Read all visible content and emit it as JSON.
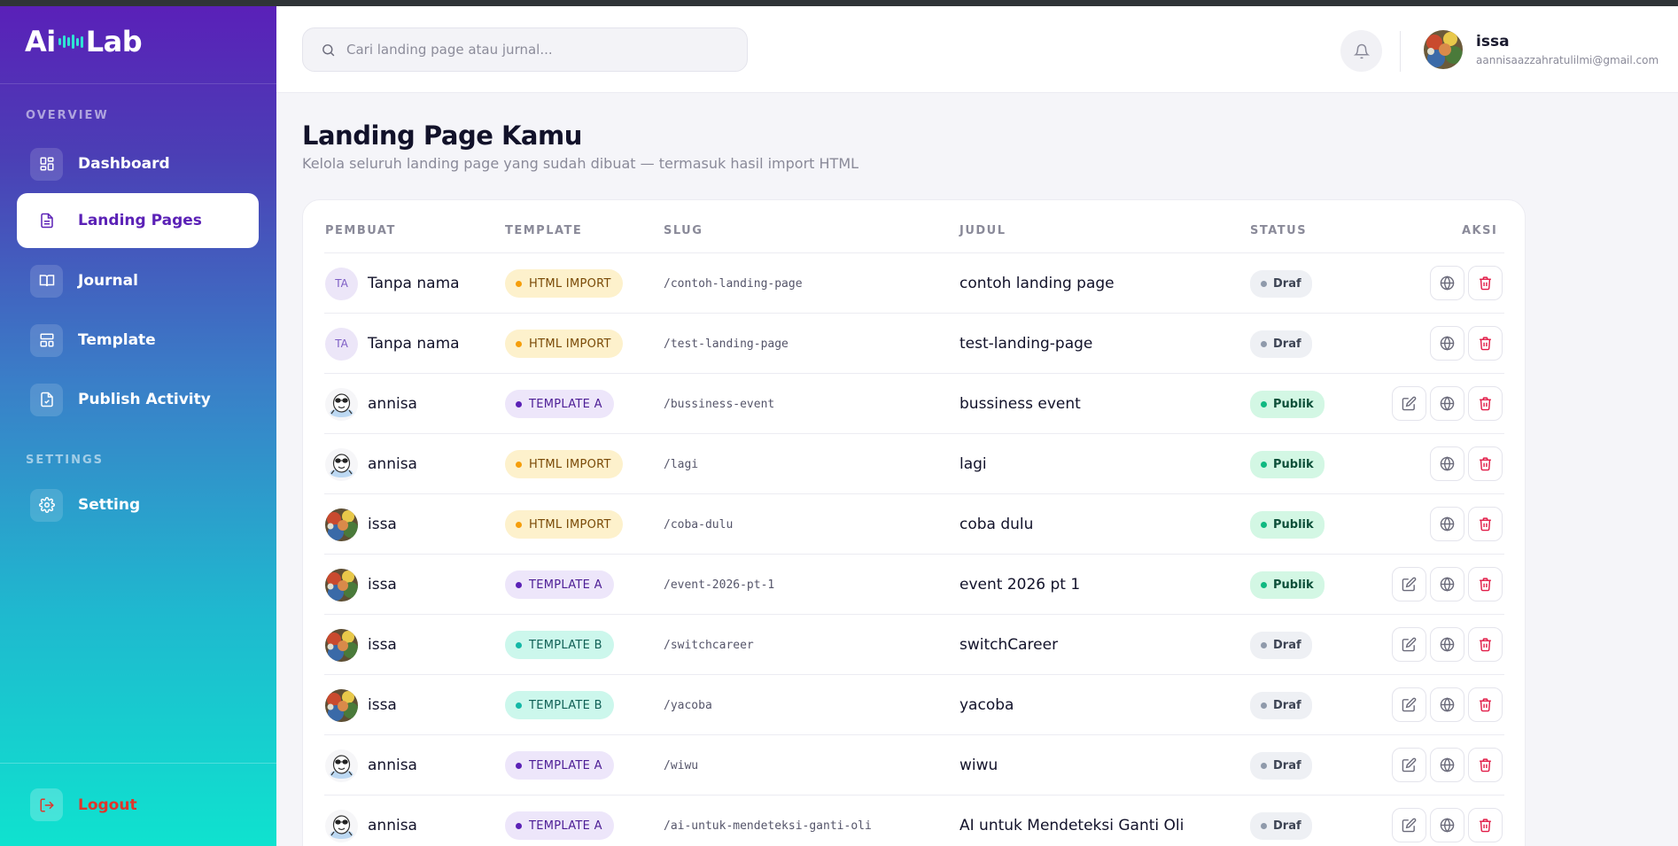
{
  "brand": {
    "prefix": "Ai",
    "suffix": "Lab"
  },
  "sidebar": {
    "sections": {
      "overview": "OVERVIEW",
      "settings": "SETTINGS"
    },
    "items": [
      {
        "label": "Dashboard",
        "icon": "dashboard-grid-icon"
      },
      {
        "label": "Landing Pages",
        "icon": "document-icon",
        "active": true
      },
      {
        "label": "Journal",
        "icon": "book-icon"
      },
      {
        "label": "Template",
        "icon": "layout-icon"
      },
      {
        "label": "Publish Activity",
        "icon": "file-check-icon"
      },
      {
        "label": "Setting",
        "icon": "gear-icon"
      }
    ],
    "logout": "Logout"
  },
  "header": {
    "search_placeholder": "Cari landing page atau jurnal...",
    "user": {
      "name": "issa",
      "email": "aannisaazzahratulilmi@gmail.com"
    }
  },
  "main": {
    "title": "Landing Page Kamu",
    "subtitle": "Kelola seluruh landing page yang sudah dibuat — termasuk hasil import HTML"
  },
  "table": {
    "headers": [
      "PEMBUAT",
      "TEMPLATE",
      "SLUG",
      "JUDUL",
      "STATUS",
      "AKSI"
    ],
    "rows": [
      {
        "creator": "Tanpa nama",
        "avatar": "initials",
        "initials": "TA",
        "template": "HTML IMPORT",
        "slug": "/contoh-landing-page",
        "title": "contoh landing page",
        "status": "Draf",
        "editable": false
      },
      {
        "creator": "Tanpa nama",
        "avatar": "initials",
        "initials": "TA",
        "template": "HTML IMPORT",
        "slug": "/test-landing-page",
        "title": "test-landing-page",
        "status": "Draf",
        "editable": false
      },
      {
        "creator": "annisa",
        "avatar": "mascot",
        "template": "TEMPLATE A",
        "slug": "/bussiness-event",
        "title": "bussiness event",
        "status": "Publik",
        "editable": true
      },
      {
        "creator": "annisa",
        "avatar": "mascot",
        "template": "HTML IMPORT",
        "slug": "/lagi",
        "title": "lagi",
        "status": "Publik",
        "editable": false
      },
      {
        "creator": "issa",
        "avatar": "photo",
        "template": "HTML IMPORT",
        "slug": "/coba-dulu",
        "title": "coba dulu",
        "status": "Publik",
        "editable": false
      },
      {
        "creator": "issa",
        "avatar": "photo",
        "template": "TEMPLATE A",
        "slug": "/event-2026-pt-1",
        "title": "event 2026 pt 1",
        "status": "Publik",
        "editable": true
      },
      {
        "creator": "issa",
        "avatar": "photo",
        "template": "TEMPLATE B",
        "slug": "/switchcareer",
        "title": "switchCareer",
        "status": "Draf",
        "editable": true
      },
      {
        "creator": "issa",
        "avatar": "photo",
        "template": "TEMPLATE B",
        "slug": "/yacoba",
        "title": "yacoba",
        "status": "Draf",
        "editable": true
      },
      {
        "creator": "annisa",
        "avatar": "mascot",
        "template": "TEMPLATE A",
        "slug": "/wiwu",
        "title": "wiwu",
        "status": "Draf",
        "editable": true
      },
      {
        "creator": "annisa",
        "avatar": "mascot",
        "template": "TEMPLATE A",
        "slug": "/ai-untuk-mendeteksi-ganti-oli",
        "title": "AI untuk Mendeteksi Ganti Oli",
        "status": "Draf",
        "editable": true
      }
    ]
  },
  "colors": {
    "accent": "#5b21b6",
    "html_import_bg": "#fdf1cc",
    "html_import_dot": "#f59e0b",
    "html_import_text": "#7a4a06",
    "template_a_bg": "#ede6fa",
    "template_a_dot": "#5b21b6",
    "template_a_text": "#4c1d95",
    "template_b_bg": "#ccf7ec",
    "template_b_dot": "#14b8a6",
    "template_b_text": "#0f5f55",
    "draf_bg": "#eef0f4",
    "draf_dot": "#8f9aab",
    "draf_text": "#3d4454",
    "publik_bg": "#d3f7e4",
    "publik_dot": "#10b981",
    "publik_text": "#0d4f39",
    "delete": "#e11d48"
  }
}
